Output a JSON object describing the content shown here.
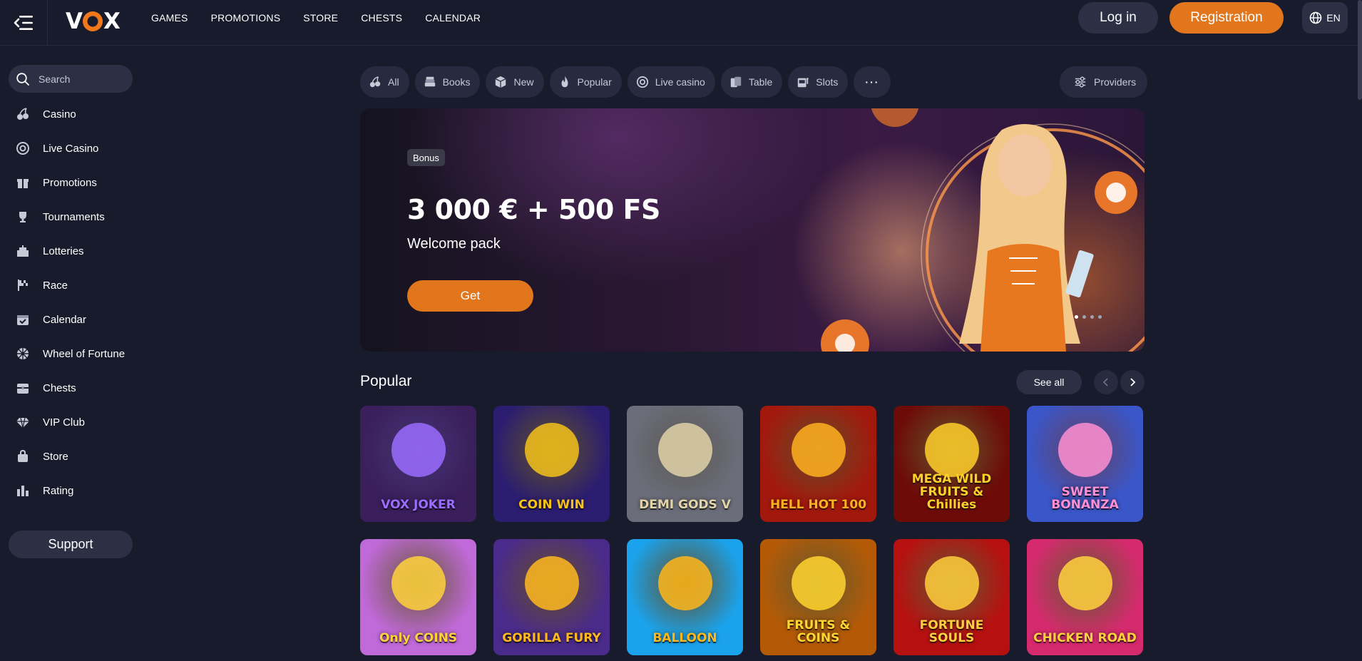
{
  "header": {
    "logo": "VOX",
    "nav": [
      "GAMES",
      "PROMOTIONS",
      "STORE",
      "CHESTS",
      "CALENDAR"
    ],
    "login_label": "Log in",
    "register_label": "Registration",
    "language": "EN"
  },
  "sidebar": {
    "search_placeholder": "Search",
    "items": [
      {
        "label": "Casino",
        "icon": "cherries-icon"
      },
      {
        "label": "Live Casino",
        "icon": "chip-icon"
      },
      {
        "label": "Promotions",
        "icon": "gift-icon"
      },
      {
        "label": "Tournaments",
        "icon": "trophy-icon"
      },
      {
        "label": "Lotteries",
        "icon": "lottery-icon"
      },
      {
        "label": "Race",
        "icon": "race-flag-icon"
      },
      {
        "label": "Calendar",
        "icon": "calendar-icon"
      },
      {
        "label": "Wheel of Fortune",
        "icon": "wheel-icon"
      },
      {
        "label": "Chests",
        "icon": "chest-icon"
      },
      {
        "label": "VIP Club",
        "icon": "diamond-icon"
      },
      {
        "label": "Store",
        "icon": "shopping-bag-icon"
      },
      {
        "label": "Rating",
        "icon": "rating-bars-icon"
      }
    ],
    "support_label": "Support"
  },
  "filters": {
    "chips": [
      {
        "label": "All",
        "icon": "cherries-icon"
      },
      {
        "label": "Books",
        "icon": "books-icon"
      },
      {
        "label": "New",
        "icon": "cube-icon"
      },
      {
        "label": "Popular",
        "icon": "flame-icon"
      },
      {
        "label": "Live casino",
        "icon": "chip-icon"
      },
      {
        "label": "Table",
        "icon": "cards-icon"
      },
      {
        "label": "Slots",
        "icon": "slot-machine-icon"
      }
    ],
    "more_label": "···",
    "providers_label": "Providers"
  },
  "banner": {
    "badge": "Bonus",
    "title": "3 000 € + 500 FS",
    "subtitle": "Welcome pack",
    "cta_label": "Get",
    "slides_total": 4,
    "active_slide": 1
  },
  "popular": {
    "title": "Popular",
    "see_all_label": "See all",
    "games": [
      {
        "name": "VOX JOKER",
        "bg": "#3a1f5c",
        "accent": "#9b6cff"
      },
      {
        "name": "COIN WIN",
        "bg": "#2b1d70",
        "accent": "#f5c21b"
      },
      {
        "name": "DEMI GODS V",
        "bg": "#6b6e7a",
        "accent": "#e2d3a8"
      },
      {
        "name": "HELL HOT 100",
        "bg": "#a3180d",
        "accent": "#ffb020"
      },
      {
        "name": "MEGA WILD FRUITS & Chillies",
        "bg": "#6d0b08",
        "accent": "#ffcf2a"
      },
      {
        "name": "SWEET BONANZA",
        "bg": "#3a56c8",
        "accent": "#ff8fd2"
      },
      {
        "name": "Only COINS",
        "bg": "#c069d8",
        "accent": "#ffd23c"
      },
      {
        "name": "GORILLA FURY",
        "bg": "#4a2a8a",
        "accent": "#ffb81e"
      },
      {
        "name": "BALLOON",
        "bg": "#1aa3ec",
        "accent": "#ffb61a"
      },
      {
        "name": "FRUITS & COINS",
        "bg": "#b45a07",
        "accent": "#ffd530"
      },
      {
        "name": "FORTUNE SOULS",
        "bg": "#b71010",
        "accent": "#ffcf3c"
      },
      {
        "name": "CHICKEN ROAD",
        "bg": "#d62a6e",
        "accent": "#ffd23c"
      }
    ]
  }
}
